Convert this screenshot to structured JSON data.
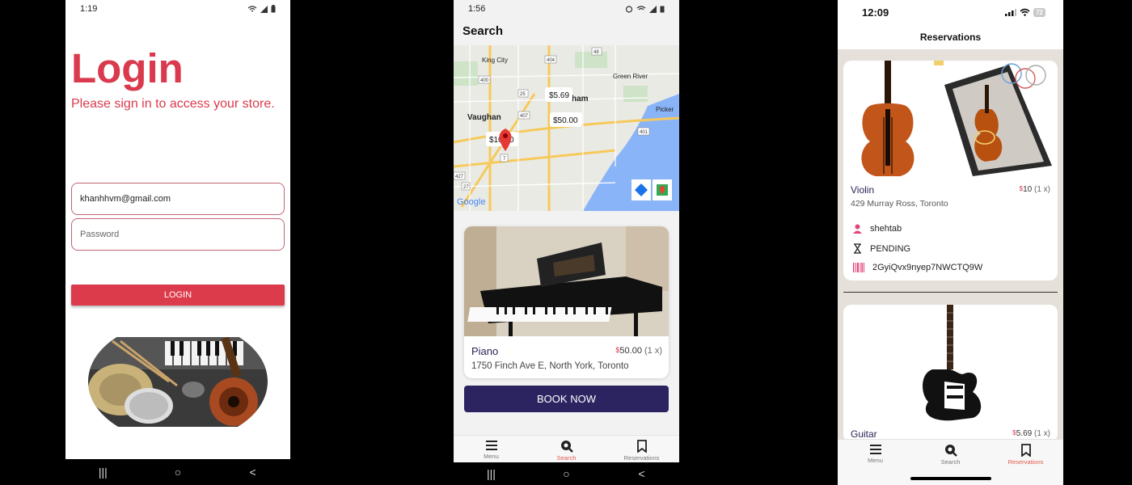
{
  "login_screen": {
    "status_time": "1:19",
    "title": "Login",
    "subtitle": "Please sign in to access your store.",
    "email_value": "khanhhvm@gmail.com",
    "password_placeholder": "Password",
    "login_button": "LOGIN",
    "nav": [
      "|||",
      "○",
      "<"
    ]
  },
  "search_screen": {
    "status_time": "1:56",
    "title": "Search",
    "map": {
      "city_labels": [
        "King City",
        "Vaughan",
        "Green River",
        "Picker",
        "ham"
      ],
      "road_labels": [
        "404",
        "48",
        "400",
        "407",
        "25",
        "401",
        "427",
        "27",
        "7"
      ],
      "price_markers": [
        "$5.69",
        "$50.00",
        "$10.00"
      ],
      "google_label": "Google"
    },
    "item": {
      "name": "Piano",
      "currency": "$",
      "price": "50.00",
      "qty": "(1 x)",
      "address": "1750 Finch Ave E, North York, Toronto"
    },
    "book_button": "BOOK NOW",
    "tabs": [
      {
        "label": "Menu",
        "icon": "menu-icon"
      },
      {
        "label": "Search",
        "icon": "search-pin-icon"
      },
      {
        "label": "Reservations",
        "icon": "bookmark-icon"
      }
    ],
    "nav": [
      "|||",
      "○",
      "<"
    ]
  },
  "reservations_screen": {
    "status_time": "12:09",
    "battery": "72",
    "title": "Reservations",
    "reservations": [
      {
        "name": "Violin",
        "currency": "$",
        "price": "10",
        "qty": "(1 x)",
        "address": "429 Murray Ross, Toronto",
        "user": "shehtab",
        "status": "PENDING",
        "code": "2GyiQvx9nyep7NWCTQ9W"
      },
      {
        "name": "Guitar",
        "currency": "$",
        "price": "5.69",
        "qty": "(1 x)"
      }
    ],
    "tabs": [
      {
        "label": "Menu",
        "icon": "menu-icon"
      },
      {
        "label": "Search",
        "icon": "search-pin-icon"
      },
      {
        "label": "Reservations",
        "icon": "bookmark-icon"
      }
    ]
  },
  "colors": {
    "brand_red": "#d93a4d",
    "brand_navy": "#2c2460",
    "active_tab": "#e35a4e"
  }
}
